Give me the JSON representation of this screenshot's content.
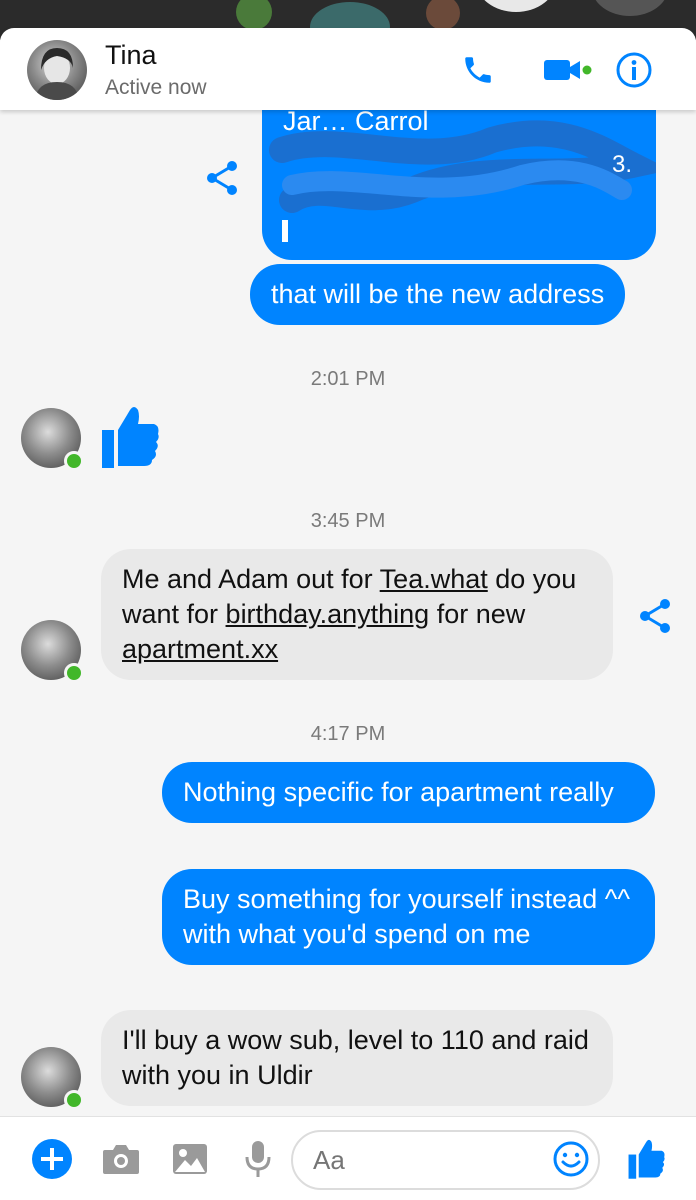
{
  "header": {
    "contact_name": "Tina",
    "status": "Active now"
  },
  "colors": {
    "accent": "#0084ff",
    "outgoing_bubble": "#0084ff",
    "incoming_bubble": "#e9e9e9",
    "online": "#42b72a"
  },
  "messages": {
    "shared_card_partial_text": "Jar… Carrol",
    "address_message": "that will be the new address",
    "time1": "2:01 PM",
    "time2": "3:45 PM",
    "tina_msg1": {
      "p1": "Me and Adam out for ",
      "link1": "Tea.what",
      "p2": " do you want for ",
      "link2": "birthday.anything",
      "p3": " for new ",
      "link3": "apartment.xx"
    },
    "time3": "4:17 PM",
    "reply1": "Nothing specific for apartment really",
    "reply2": "Buy something for yourself instead ^^ with what you'd spend on me",
    "tina_msg2": "I'll buy a wow sub, level to 110 and raid with you in Uldir"
  },
  "composer": {
    "placeholder": "Aa"
  },
  "icons": [
    "phone-icon",
    "video-call-icon",
    "info-icon",
    "share-icon",
    "thumbs-up-icon",
    "plus-icon",
    "camera-icon",
    "image-icon",
    "microphone-icon",
    "emoji-icon"
  ]
}
